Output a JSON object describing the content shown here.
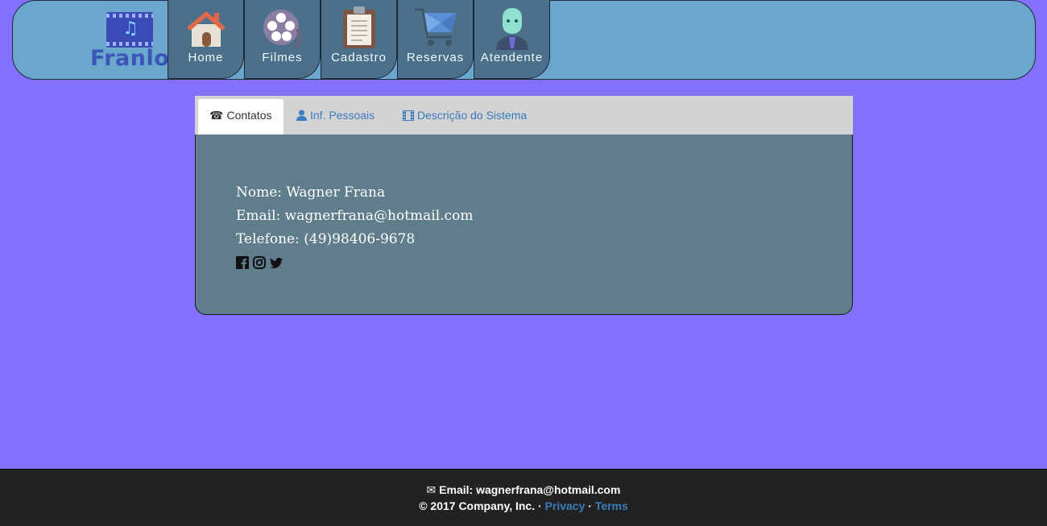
{
  "brand": {
    "name": "Franloc",
    "logo_icon": "music-film-icon"
  },
  "nav": [
    {
      "label": "Home",
      "icon": "house-icon"
    },
    {
      "label": "Filmes",
      "icon": "film-reel-icon"
    },
    {
      "label": "Cadastro",
      "icon": "clipboard-icon"
    },
    {
      "label": "Reservas",
      "icon": "shopping-cart-icon"
    },
    {
      "label": "Atendente",
      "icon": "attendant-icon"
    }
  ],
  "tabs": [
    {
      "label": "Contatos",
      "icon": "phone-icon",
      "active": true
    },
    {
      "label": "Inf. Pessoais",
      "icon": "user-icon",
      "active": false
    },
    {
      "label": "Descrição do Sistema",
      "icon": "film-icon",
      "active": false
    }
  ],
  "contact": {
    "name": "Nome: Wagner Frana",
    "email": "Email: wagnerfrana@hotmail.com",
    "phone": "Telefone: (49)98406-9678"
  },
  "social": [
    "facebook-icon",
    "instagram-icon",
    "twitter-icon"
  ],
  "footer": {
    "email_label": "Email: wagnerfrana@hotmail.com",
    "copyright": "© 2017 Company, Inc. ·",
    "privacy": "Privacy",
    "separator": "·",
    "terms": "Terms"
  },
  "colors": {
    "background": "#8370fd",
    "header": "#6ba6cd",
    "nav_item": "#4c7089",
    "panel": "#607d8b",
    "footer": "#222222",
    "link": "#3a7bbf"
  }
}
